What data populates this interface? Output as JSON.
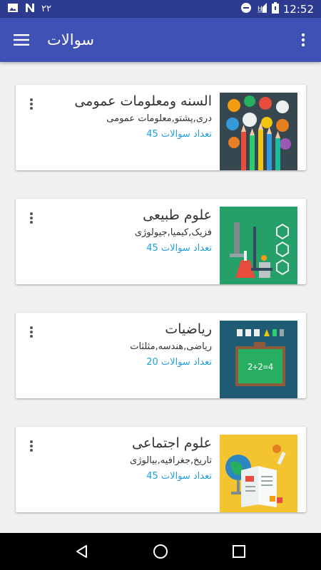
{
  "status_bar": {
    "notification_count": "۲۲",
    "time": "12:52",
    "icons": [
      "image-icon",
      "n-notification-icon",
      "do-not-disturb-icon",
      "signal-icon",
      "battery-icon"
    ]
  },
  "app_bar": {
    "title": "سوالات",
    "menu_icon": "hamburger-menu-icon",
    "overflow_icon": "more-vertical-icon"
  },
  "colors": {
    "status_bar": "#2c3b8f",
    "app_bar": "#3f51b5",
    "background": "#f0f0f0",
    "count_text": "#1e9fdb",
    "nav_bar": "#000000"
  },
  "categories": [
    {
      "title": "السنه ومعلومات عمومی",
      "subtitle": "دری,پشتو,معلومات عمومی",
      "count": "تعداد سوالات 45",
      "image": "languages-pencils-illustration"
    },
    {
      "title": "علوم طبیعی",
      "subtitle": "فزیک,کیمیا,جیولوژی",
      "count": "تعداد سوالات 45",
      "image": "science-lab-illustration"
    },
    {
      "title": "ریاضیات",
      "subtitle": "ریاضی,هندسه,مثلثات",
      "count": "تعداد سوالات 20",
      "image": "math-chalkboard-illustration",
      "board_text": "2+2=4"
    },
    {
      "title": "علوم اجتماعی",
      "subtitle": "تاریخ,جغرافیه,بیالوژی",
      "count": "تعداد سوالات 45",
      "image": "social-science-book-globe-illustration"
    }
  ],
  "nav_bar": {
    "back_icon": "back-triangle-icon",
    "home_icon": "home-circle-icon",
    "recents_icon": "recents-square-icon"
  }
}
